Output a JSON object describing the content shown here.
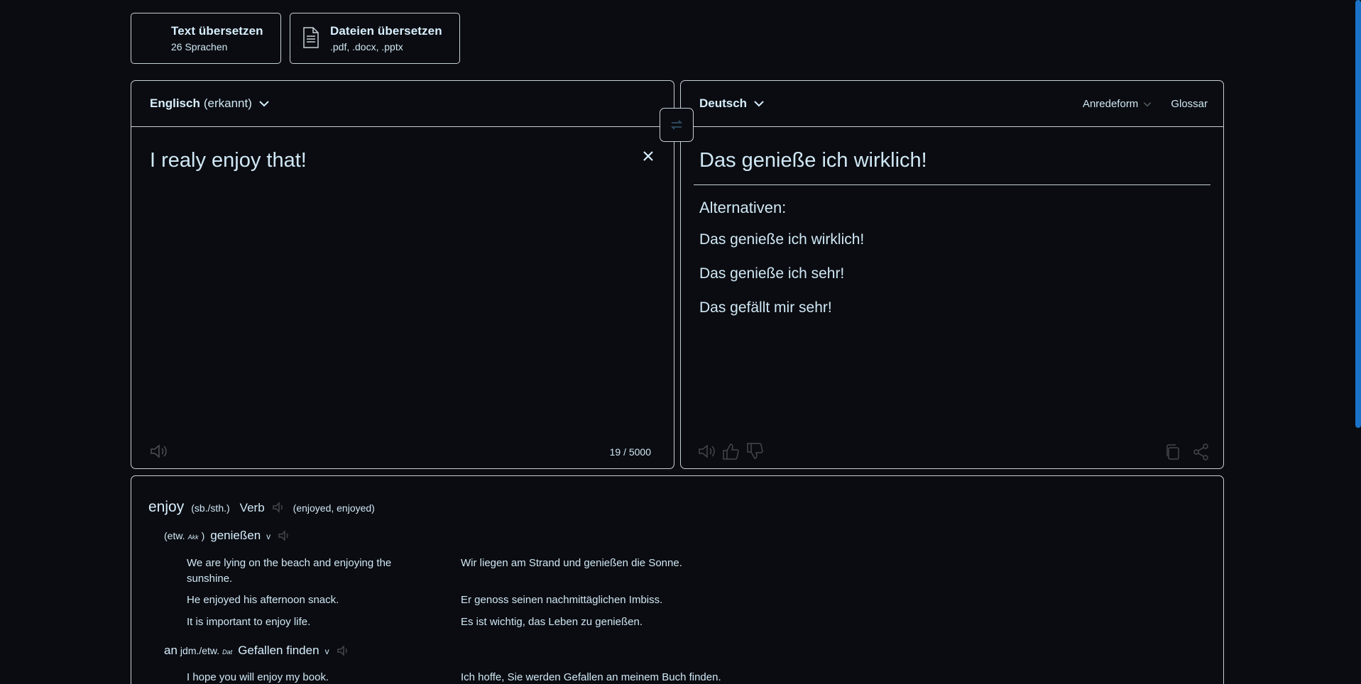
{
  "tabs": [
    {
      "title": "Text übersetzen",
      "subtitle": "26 Sprachen"
    },
    {
      "title": "Dateien übersetzen",
      "subtitle": ".pdf, .docx, .pptx"
    }
  ],
  "source": {
    "language": "Englisch",
    "detected": "(erkannt)",
    "text": "I realy enjoy that!",
    "counter": "19 / 5000"
  },
  "target": {
    "language": "Deutsch",
    "formality": "Anredeform",
    "glossary": "Glossar",
    "text": "Das genieße ich wirklich!",
    "alternatives_label": "Alternativen:",
    "alternatives": [
      "Das genieße ich wirklich!",
      "Das genieße ich sehr!",
      "Das gefällt mir sehr!"
    ]
  },
  "dictionary": {
    "word": "enjoy",
    "object": "(sb./sth.)",
    "pos": "Verb",
    "forms_open": "(enjoyed",
    "forms_sep": ",",
    "forms_close": "enjoyed)",
    "senses": [
      {
        "prefix": "(etw.",
        "sup": "Akk",
        "prefix_end": ")",
        "translation": "genießen",
        "type": "v",
        "examples": [
          {
            "en": "We are lying on the beach and enjoying the sunshine.",
            "de": "Wir liegen am Strand und genießen die Sonne."
          },
          {
            "en": "He enjoyed his afternoon snack.",
            "de": "Er genoss seinen nachmittäglichen Imbiss."
          },
          {
            "en": "It is important to enjoy life.",
            "de": "Es ist wichtig, das Leben zu genießen."
          }
        ]
      },
      {
        "prefix": "an",
        "prefix2": "jdm./etw.",
        "sup": "Dat",
        "translation": "Gefallen finden",
        "type": "v",
        "examples": [
          {
            "en": "I hope you will enjoy my book.",
            "de": "Ich hoffe, Sie werden Gefallen an meinem Buch finden."
          }
        ]
      }
    ]
  },
  "colors": {
    "background": "#0b0c11",
    "border": "#c6d0d8",
    "text": "#cfe8f5",
    "scrollbar": "#1a73c9"
  },
  "icons": [
    "document-icon",
    "chevron-down-icon",
    "swap-icon",
    "close-icon",
    "speaker-icon",
    "thumbs-up-icon",
    "thumbs-down-icon",
    "copy-icon",
    "share-icon"
  ]
}
